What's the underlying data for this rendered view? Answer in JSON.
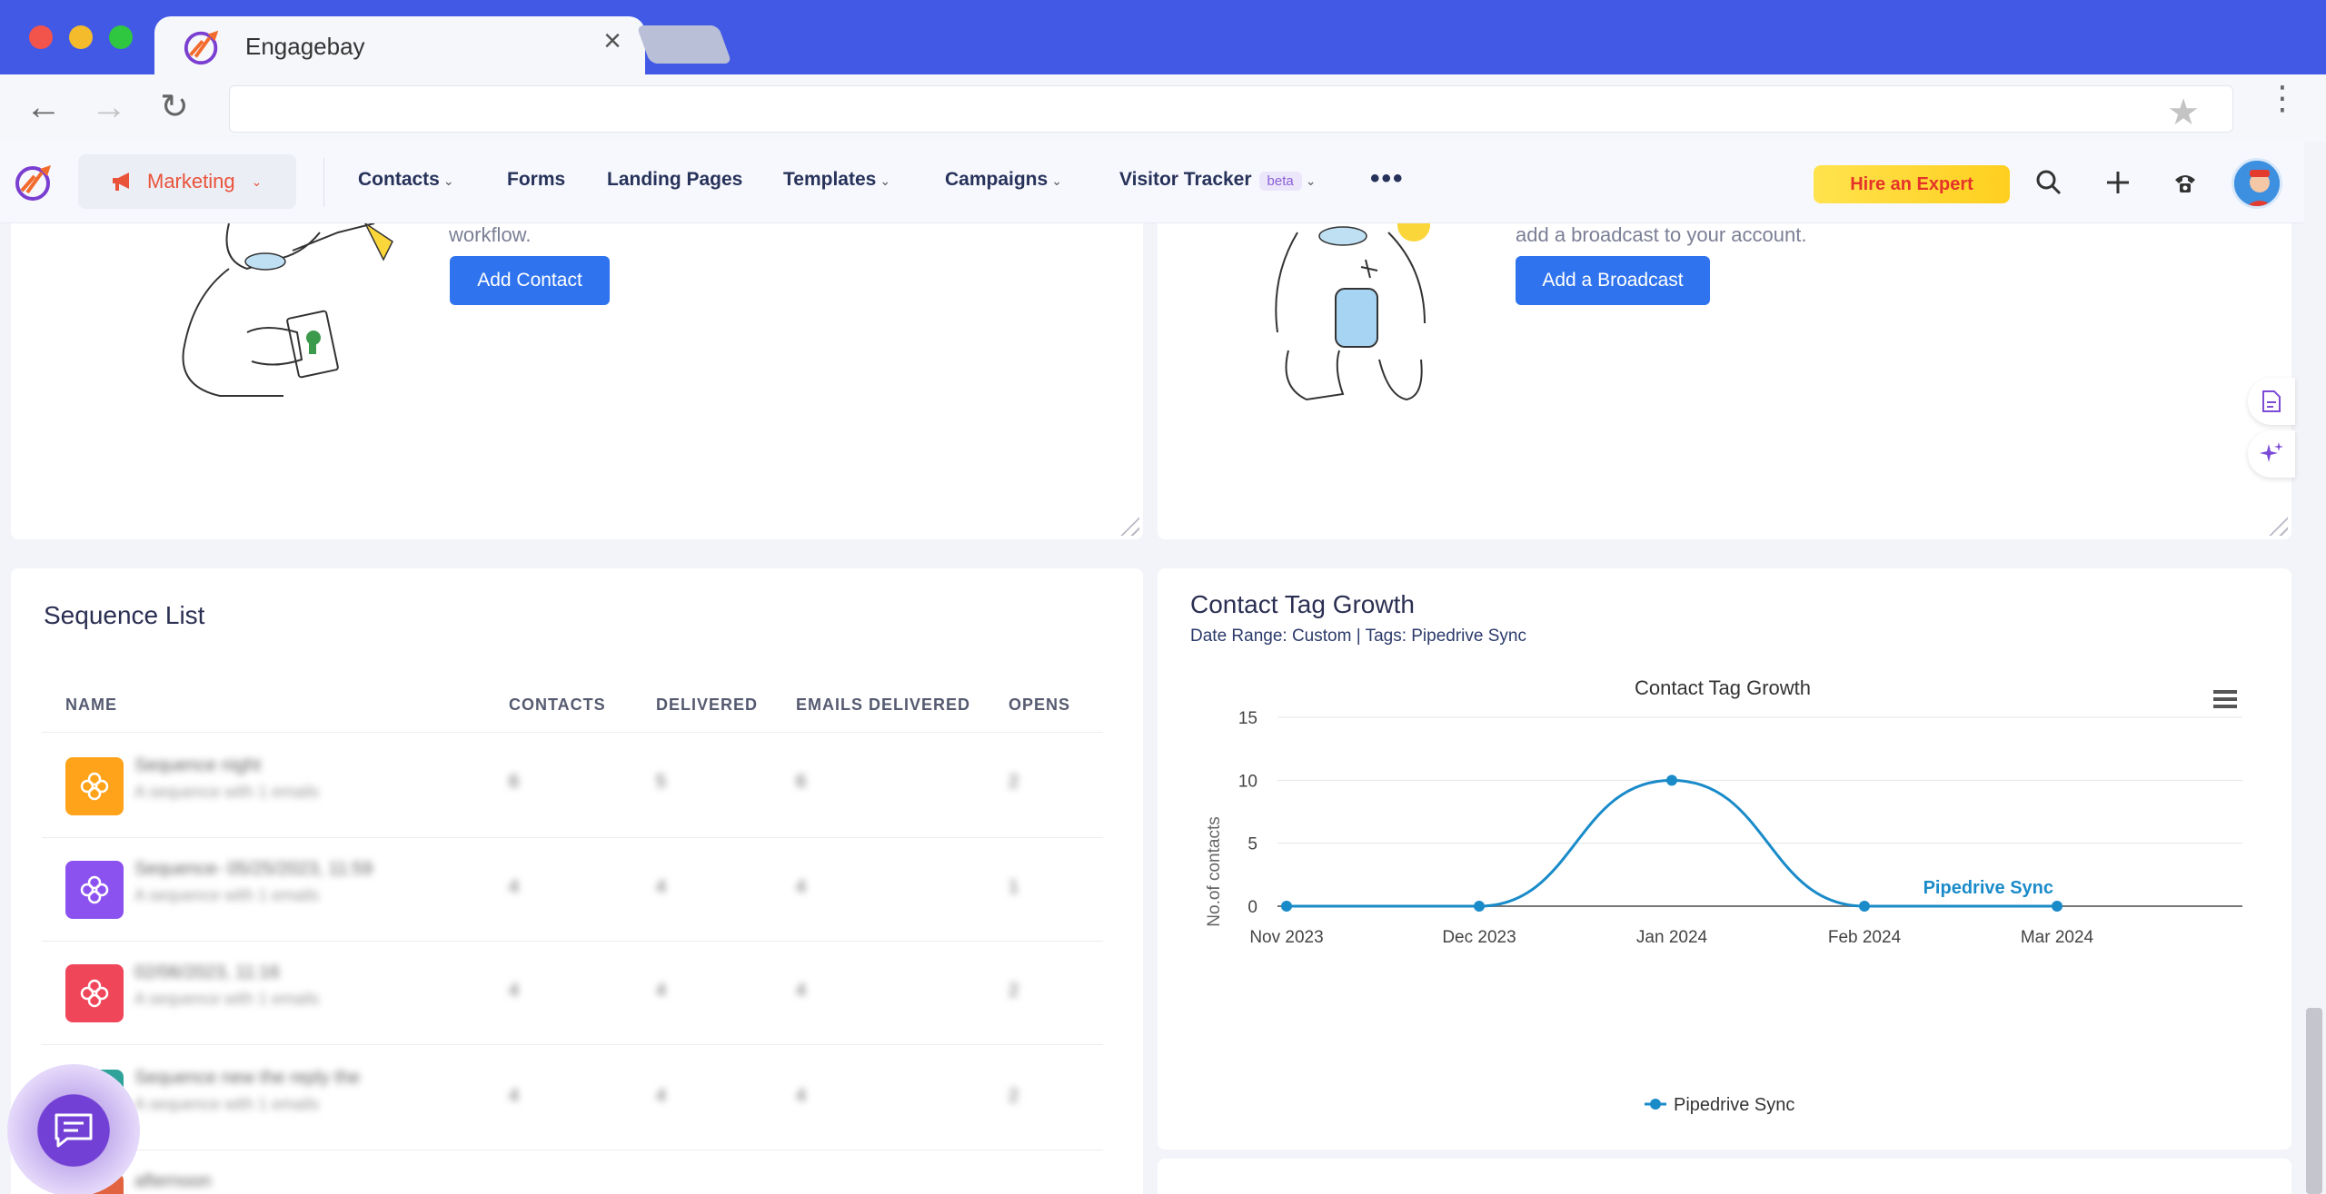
{
  "browser": {
    "tab_title": "Engagebay",
    "tab_close": "×",
    "url": "",
    "back_icon": "arrow-left-icon",
    "forward_icon": "arrow-right-icon",
    "reload_icon": "reload-icon"
  },
  "appnav": {
    "marketing": "Marketing",
    "items": [
      "Contacts",
      "Forms",
      "Landing Pages",
      "Templates",
      "Campaigns",
      "Visitor Tracker"
    ],
    "beta": "beta",
    "more": "•••",
    "hire": "Hire an Expert"
  },
  "cards": {
    "contact_text": "workflow.",
    "contact_button": "Add Contact",
    "broadcast_text": "add a broadcast to your account.",
    "broadcast_button": "Add a Broadcast"
  },
  "sequence": {
    "title": "Sequence List",
    "columns": [
      "NAME",
      "CONTACTS",
      "DELIVERED",
      "EMAILS DELIVERED",
      "OPENS"
    ],
    "rows": [
      {
        "name": "Sequence night",
        "sub": "A sequence with 1 emails",
        "contacts": "6",
        "delivered": "5",
        "emails": "6",
        "opens": "2",
        "color": "#ffa31a"
      },
      {
        "name": "Sequence- 05/25/2023, 11:59",
        "sub": "A sequence with 1 emails",
        "contacts": "4",
        "delivered": "4",
        "emails": "4",
        "opens": "1",
        "color": "#8b52f0"
      },
      {
        "name": "02/06/2023, 11:16",
        "sub": "A sequence with 1 emails",
        "contacts": "4",
        "delivered": "4",
        "emails": "4",
        "opens": "2",
        "color": "#f0465a"
      },
      {
        "name": "Sequence new the reply the",
        "sub": "A sequence with 1 emails",
        "contacts": "4",
        "delivered": "4",
        "emails": "4",
        "opens": "2",
        "color": "#2fa39a"
      },
      {
        "name": "afternoon",
        "sub": "",
        "contacts": "",
        "delivered": "",
        "emails": "",
        "opens": "",
        "color": "#e2633f"
      }
    ]
  },
  "growth": {
    "title": "Contact Tag Growth",
    "subtitle": "Date Range: Custom | Tags: Pipedrive Sync"
  },
  "chart_data": {
    "type": "line",
    "title": "Contact Tag Growth",
    "xlabel": "",
    "ylabel": "No.of contacts",
    "categories": [
      "Nov 2023",
      "Dec 2023",
      "Jan 2024",
      "Feb 2024",
      "Mar 2024"
    ],
    "series": [
      {
        "name": "Pipedrive Sync",
        "values": [
          0,
          0,
          10,
          0,
          0
        ],
        "color": "#1a8bc9"
      }
    ],
    "ylim": [
      0,
      15
    ],
    "yticks": [
      0,
      5,
      10,
      15
    ],
    "grid": true,
    "legend": "bottom",
    "series_label": "Pipedrive Sync"
  }
}
